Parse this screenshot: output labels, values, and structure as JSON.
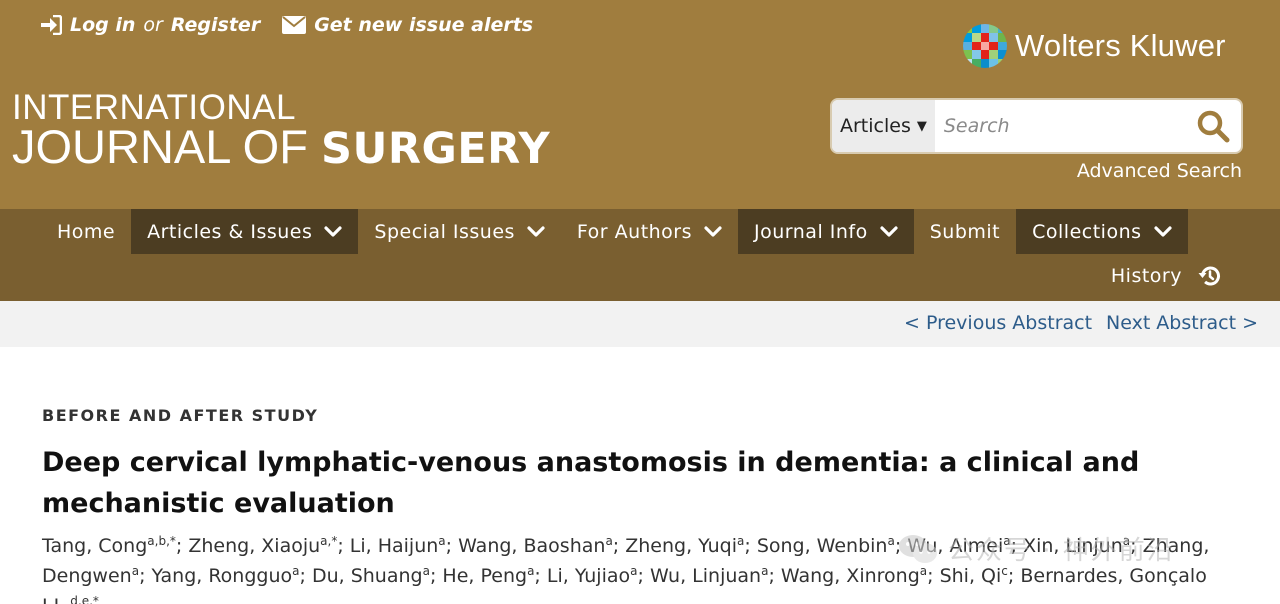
{
  "header": {
    "login_label": "Log in",
    "or_label": "or",
    "register_label": "Register",
    "alerts_label": "Get new issue alerts",
    "publisher_name": "Wolters Kluwer",
    "journal_line1": "INTERNATIONAL",
    "journal_line2_light": "JOURNAL OF",
    "journal_line2_bold": "SURGERY",
    "bg_color": "#a07d3e"
  },
  "search": {
    "scope_selected": "Articles",
    "placeholder": "Search",
    "advanced_label": "Advanced Search"
  },
  "nav": {
    "items": [
      {
        "label": "Home",
        "has_dropdown": false,
        "active": false
      },
      {
        "label": "Articles & Issues",
        "has_dropdown": true,
        "active": true
      },
      {
        "label": "Special Issues",
        "has_dropdown": true,
        "active": false
      },
      {
        "label": "For Authors",
        "has_dropdown": true,
        "active": false
      },
      {
        "label": "Journal Info",
        "has_dropdown": true,
        "active": true
      },
      {
        "label": "Submit",
        "has_dropdown": false,
        "active": false
      },
      {
        "label": "Collections",
        "has_dropdown": true,
        "active": true
      }
    ],
    "history_label": "History",
    "bg_color": "#7a5f30",
    "active_color": "#4c3d22"
  },
  "pager": {
    "previous_label": "< Previous Abstract",
    "next_label": "Next Abstract >",
    "link_color": "#2d5c8a"
  },
  "article": {
    "type": "BEFORE AND AFTER STUDY",
    "title": "Deep cervical lymphatic-venous anastomosis in dementia: a clinical and mechanistic evaluation",
    "authors": [
      {
        "name": "Tang, Cong",
        "sup": "a,b,*"
      },
      {
        "name": "Zheng, Xiaoju",
        "sup": "a,*"
      },
      {
        "name": "Li, Haijun",
        "sup": "a"
      },
      {
        "name": "Wang, Baoshan",
        "sup": "a"
      },
      {
        "name": "Zheng, Yuqi",
        "sup": "a"
      },
      {
        "name": "Song, Wenbin",
        "sup": "a"
      },
      {
        "name": "Wu, Aimei",
        "sup": "a"
      },
      {
        "name": "Xin, Linjun",
        "sup": "a"
      },
      {
        "name": "Zhang, Dengwen",
        "sup": "a"
      },
      {
        "name": "Yang, Rongguo",
        "sup": "a"
      },
      {
        "name": "Du, Shuang",
        "sup": "a"
      },
      {
        "name": "He, Peng",
        "sup": "a"
      },
      {
        "name": "Li, Yujiao",
        "sup": "a"
      },
      {
        "name": "Wu, Linjuan",
        "sup": "a"
      },
      {
        "name": "Wang, Xinrong",
        "sup": "a"
      },
      {
        "name": "Shi, Qi",
        "sup": "c"
      },
      {
        "name": "Bernardes, Gonçalo J.L.",
        "sup": "d,e,*"
      }
    ]
  },
  "watermark": {
    "text": "公众号 · 神外前沿"
  }
}
